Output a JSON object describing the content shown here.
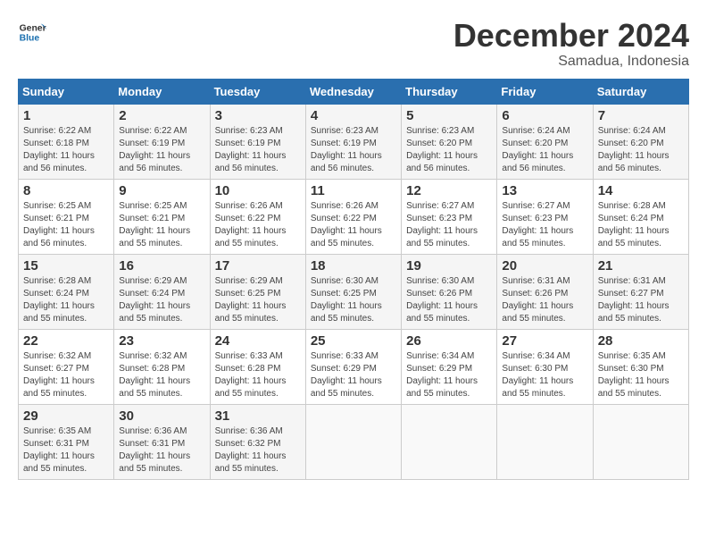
{
  "logo": {
    "line1": "General",
    "line2": "Blue"
  },
  "title": "December 2024",
  "location": "Samadua, Indonesia",
  "days_of_week": [
    "Sunday",
    "Monday",
    "Tuesday",
    "Wednesday",
    "Thursday",
    "Friday",
    "Saturday"
  ],
  "weeks": [
    [
      {
        "day": 1,
        "sunrise": "6:22 AM",
        "sunset": "6:18 PM",
        "daylight": "11 hours and 56 minutes."
      },
      {
        "day": 2,
        "sunrise": "6:22 AM",
        "sunset": "6:19 PM",
        "daylight": "11 hours and 56 minutes."
      },
      {
        "day": 3,
        "sunrise": "6:23 AM",
        "sunset": "6:19 PM",
        "daylight": "11 hours and 56 minutes."
      },
      {
        "day": 4,
        "sunrise": "6:23 AM",
        "sunset": "6:19 PM",
        "daylight": "11 hours and 56 minutes."
      },
      {
        "day": 5,
        "sunrise": "6:23 AM",
        "sunset": "6:20 PM",
        "daylight": "11 hours and 56 minutes."
      },
      {
        "day": 6,
        "sunrise": "6:24 AM",
        "sunset": "6:20 PM",
        "daylight": "11 hours and 56 minutes."
      },
      {
        "day": 7,
        "sunrise": "6:24 AM",
        "sunset": "6:20 PM",
        "daylight": "11 hours and 56 minutes."
      }
    ],
    [
      {
        "day": 8,
        "sunrise": "6:25 AM",
        "sunset": "6:21 PM",
        "daylight": "11 hours and 56 minutes."
      },
      {
        "day": 9,
        "sunrise": "6:25 AM",
        "sunset": "6:21 PM",
        "daylight": "11 hours and 55 minutes."
      },
      {
        "day": 10,
        "sunrise": "6:26 AM",
        "sunset": "6:22 PM",
        "daylight": "11 hours and 55 minutes."
      },
      {
        "day": 11,
        "sunrise": "6:26 AM",
        "sunset": "6:22 PM",
        "daylight": "11 hours and 55 minutes."
      },
      {
        "day": 12,
        "sunrise": "6:27 AM",
        "sunset": "6:23 PM",
        "daylight": "11 hours and 55 minutes."
      },
      {
        "day": 13,
        "sunrise": "6:27 AM",
        "sunset": "6:23 PM",
        "daylight": "11 hours and 55 minutes."
      },
      {
        "day": 14,
        "sunrise": "6:28 AM",
        "sunset": "6:24 PM",
        "daylight": "11 hours and 55 minutes."
      }
    ],
    [
      {
        "day": 15,
        "sunrise": "6:28 AM",
        "sunset": "6:24 PM",
        "daylight": "11 hours and 55 minutes."
      },
      {
        "day": 16,
        "sunrise": "6:29 AM",
        "sunset": "6:24 PM",
        "daylight": "11 hours and 55 minutes."
      },
      {
        "day": 17,
        "sunrise": "6:29 AM",
        "sunset": "6:25 PM",
        "daylight": "11 hours and 55 minutes."
      },
      {
        "day": 18,
        "sunrise": "6:30 AM",
        "sunset": "6:25 PM",
        "daylight": "11 hours and 55 minutes."
      },
      {
        "day": 19,
        "sunrise": "6:30 AM",
        "sunset": "6:26 PM",
        "daylight": "11 hours and 55 minutes."
      },
      {
        "day": 20,
        "sunrise": "6:31 AM",
        "sunset": "6:26 PM",
        "daylight": "11 hours and 55 minutes."
      },
      {
        "day": 21,
        "sunrise": "6:31 AM",
        "sunset": "6:27 PM",
        "daylight": "11 hours and 55 minutes."
      }
    ],
    [
      {
        "day": 22,
        "sunrise": "6:32 AM",
        "sunset": "6:27 PM",
        "daylight": "11 hours and 55 minutes."
      },
      {
        "day": 23,
        "sunrise": "6:32 AM",
        "sunset": "6:28 PM",
        "daylight": "11 hours and 55 minutes."
      },
      {
        "day": 24,
        "sunrise": "6:33 AM",
        "sunset": "6:28 PM",
        "daylight": "11 hours and 55 minutes."
      },
      {
        "day": 25,
        "sunrise": "6:33 AM",
        "sunset": "6:29 PM",
        "daylight": "11 hours and 55 minutes."
      },
      {
        "day": 26,
        "sunrise": "6:34 AM",
        "sunset": "6:29 PM",
        "daylight": "11 hours and 55 minutes."
      },
      {
        "day": 27,
        "sunrise": "6:34 AM",
        "sunset": "6:30 PM",
        "daylight": "11 hours and 55 minutes."
      },
      {
        "day": 28,
        "sunrise": "6:35 AM",
        "sunset": "6:30 PM",
        "daylight": "11 hours and 55 minutes."
      }
    ],
    [
      {
        "day": 29,
        "sunrise": "6:35 AM",
        "sunset": "6:31 PM",
        "daylight": "11 hours and 55 minutes."
      },
      {
        "day": 30,
        "sunrise": "6:36 AM",
        "sunset": "6:31 PM",
        "daylight": "11 hours and 55 minutes."
      },
      {
        "day": 31,
        "sunrise": "6:36 AM",
        "sunset": "6:32 PM",
        "daylight": "11 hours and 55 minutes."
      },
      null,
      null,
      null,
      null
    ]
  ]
}
